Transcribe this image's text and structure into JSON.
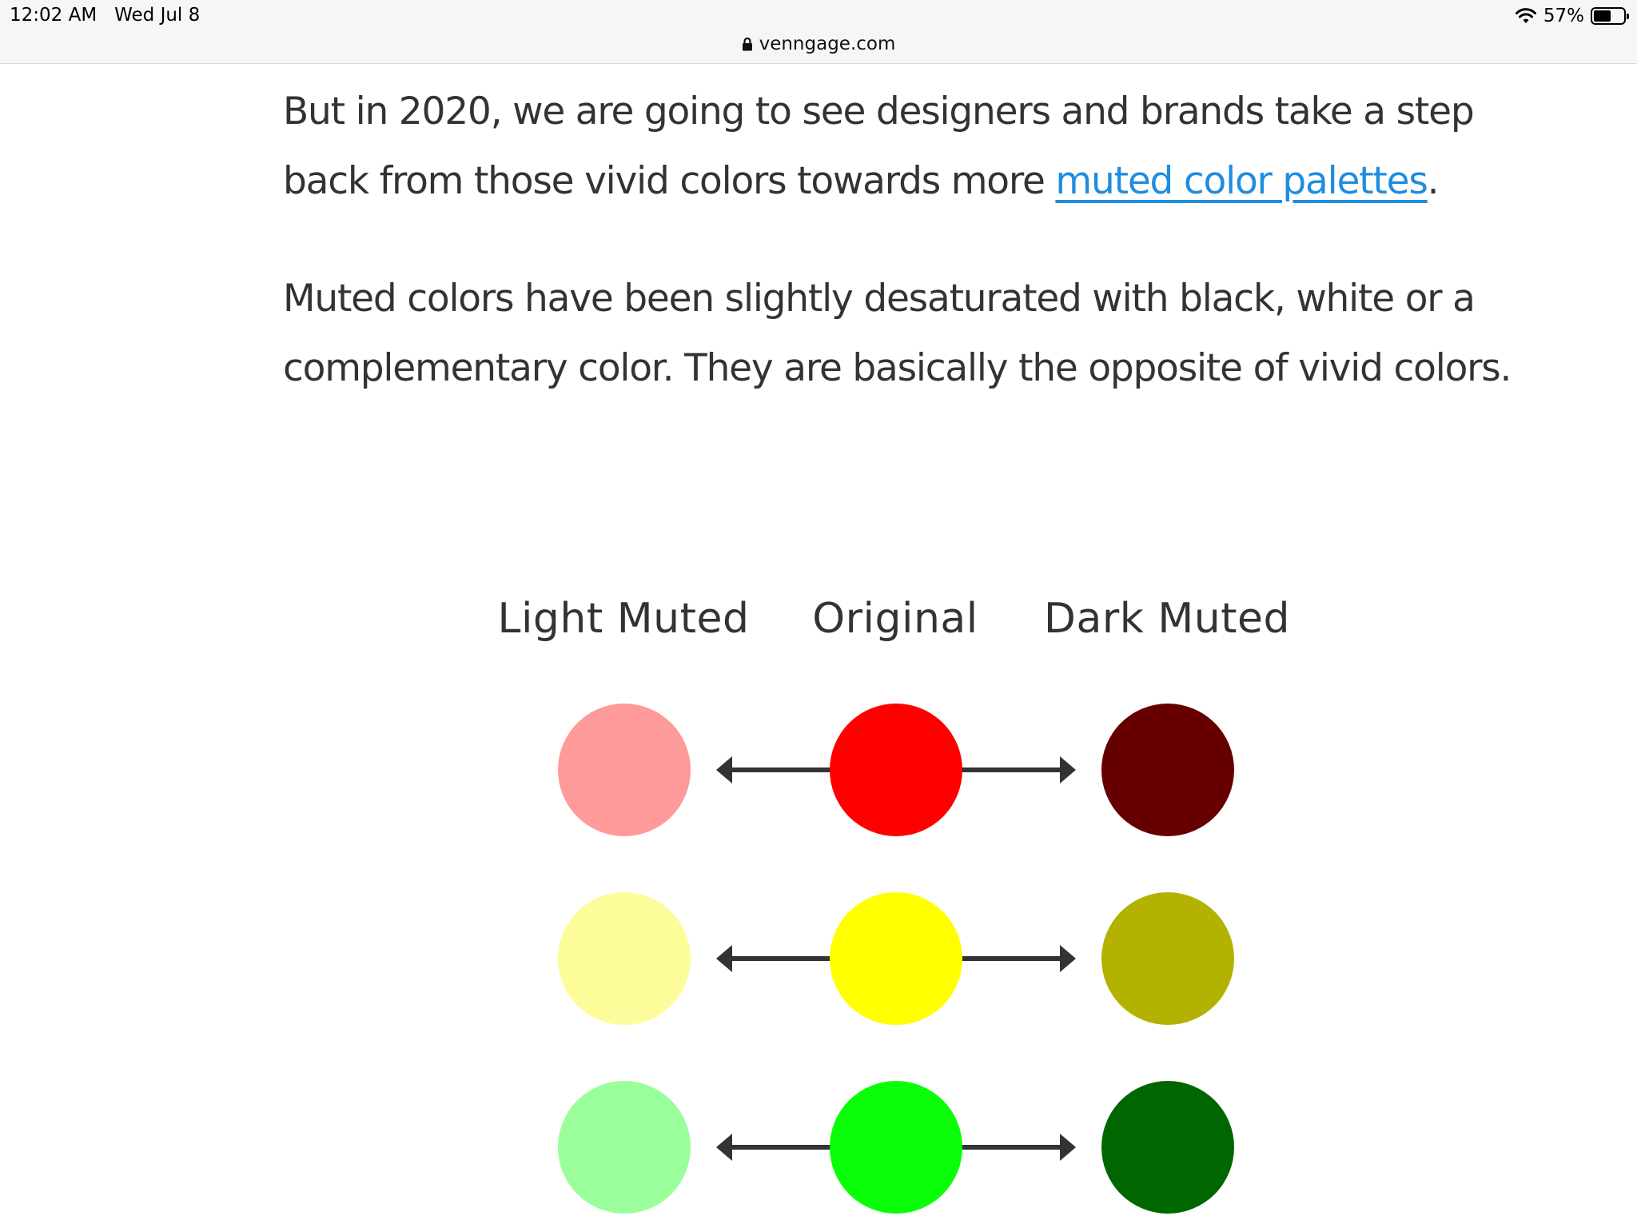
{
  "status_bar": {
    "time": "12:02 AM",
    "date": "Wed Jul 8",
    "battery_percent": "57%",
    "battery_level": 0.57,
    "icons": [
      "wifi-icon",
      "battery-icon"
    ]
  },
  "browser": {
    "url": "venngage.com",
    "secure_icon": "lock-icon"
  },
  "article": {
    "paragraph1_before_link": "But in 2020, we are going to see designers and brands take a step back from those vivid colors towards more ",
    "paragraph1_link": "muted color palettes",
    "paragraph1_after_link": ".",
    "paragraph2": "Muted colors have been slightly desaturated with black, white or a complementary color. They are basically the opposite of vivid colors."
  },
  "infographic": {
    "columns": [
      "Light Muted",
      "Original",
      "Dark Muted"
    ],
    "rows": [
      {
        "light": "#fe9a99",
        "original": "#ff0000",
        "dark": "#660000"
      },
      {
        "light": "#fcfd9a",
        "original": "#ffff00",
        "dark": "#b3b200"
      },
      {
        "light": "#9afe9a",
        "original": "#0afe0a",
        "dark": "#006600"
      }
    ],
    "arrow_color": "#333333"
  }
}
